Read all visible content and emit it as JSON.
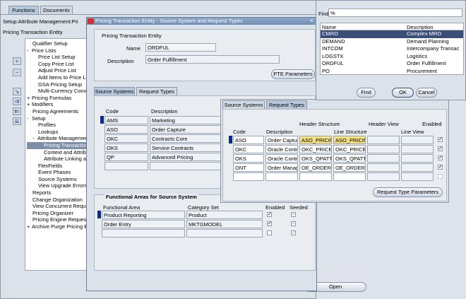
{
  "main": {
    "tabs": [
      "Functions",
      "Documents"
    ],
    "setup_label": "Setup:Attribute Management:Pri",
    "pricing_entity_label": "Pricing Transaction Entity",
    "tree": [
      {
        "label": "Qualifier Setup",
        "indent": 1,
        "prefix": ""
      },
      {
        "label": "Price Lists",
        "indent": 0,
        "prefix": "-"
      },
      {
        "label": "Price List Setup",
        "indent": 2,
        "prefix": ""
      },
      {
        "label": "Copy Price List",
        "indent": 2,
        "prefix": ""
      },
      {
        "label": "Adjust Price List",
        "indent": 2,
        "prefix": ""
      },
      {
        "label": "Add Items to Price L",
        "indent": 2,
        "prefix": ""
      },
      {
        "label": "GSA Pricing Setup",
        "indent": 2,
        "prefix": ""
      },
      {
        "label": "Multi-Currency Conve",
        "indent": 2,
        "prefix": ""
      },
      {
        "label": "Pricing Formulas",
        "indent": 0,
        "prefix": "+"
      },
      {
        "label": "Modifiers",
        "indent": 0,
        "prefix": "+"
      },
      {
        "label": "Pricing Agreements",
        "indent": 1,
        "prefix": ""
      },
      {
        "label": "Setup",
        "indent": 0,
        "prefix": "-"
      },
      {
        "label": "Profiles",
        "indent": 2,
        "prefix": ""
      },
      {
        "label": "Lookups",
        "indent": 2,
        "prefix": ""
      },
      {
        "label": "Attribute Management",
        "indent": 1,
        "prefix": "-"
      },
      {
        "label": "Pricing Transaction",
        "indent": 3,
        "prefix": "",
        "selected": true
      },
      {
        "label": "Context and Attribu",
        "indent": 3,
        "prefix": ""
      },
      {
        "label": "Attribute Linking an",
        "indent": 3,
        "prefix": ""
      },
      {
        "label": "FlexFields",
        "indent": 2,
        "prefix": ""
      },
      {
        "label": "Event Phases",
        "indent": 2,
        "prefix": ""
      },
      {
        "label": "Source Systems",
        "indent": 2,
        "prefix": ""
      },
      {
        "label": "View Upgrade Errors",
        "indent": 2,
        "prefix": ""
      },
      {
        "label": "Reports",
        "indent": 1,
        "prefix": ""
      },
      {
        "label": "Change Organization",
        "indent": 1,
        "prefix": ""
      },
      {
        "label": "View Concurrent Reque",
        "indent": 1,
        "prefix": ""
      },
      {
        "label": "Pricing Organizer",
        "indent": 1,
        "prefix": ""
      },
      {
        "label": "Pricing Engine Request Viewer",
        "indent": 1,
        "prefix": ""
      },
      {
        "label": "Archive Purge Pricing Entities",
        "indent": 0,
        "prefix": "+"
      }
    ],
    "side_buttons": [
      "+",
      "−",
      "↘",
      "⇉",
      "⇇",
      "⇊"
    ],
    "open_button": "Open"
  },
  "pte": {
    "title": "Pricing Transaction Entity - Source System and Request Types",
    "section_label": "Pricing Transaction Entity",
    "name_label": "Name",
    "name_value": "ORDFUL",
    "description_label": "Description",
    "description_value": "Order Fulfillment",
    "params_button": "PTE Parameters",
    "tabs": [
      "Source Systems",
      "Request Types"
    ],
    "col_code": "Code",
    "col_description": "Description",
    "rows": [
      {
        "code": "AMS",
        "description": "Marketing"
      },
      {
        "code": "ASO",
        "description": "Order Capture"
      },
      {
        "code": "OKC",
        "description": "Contracts Core"
      },
      {
        "code": "OKS",
        "description": "Service Contracts"
      },
      {
        "code": "QP",
        "description": "Advanced Pricing"
      },
      {
        "code": "",
        "description": ""
      }
    ],
    "functional_title": "Functional Areas for Source System",
    "fa_col_area": "Functional Area",
    "fa_col_category": "Category Set",
    "fa_col_enabled": "Enabled",
    "fa_col_seeded": "Seeded",
    "fa_rows": [
      {
        "area": "Product Reporting",
        "category": "Product",
        "enabled": true,
        "seeded": true
      },
      {
        "area": "Order Entry",
        "category": "MKTGMODEL",
        "enabled": true,
        "seeded": true
      },
      {
        "area": "",
        "category": "",
        "enabled": false,
        "seeded": true
      }
    ]
  },
  "request": {
    "tabs": [
      "Source Systems",
      "Request Types"
    ],
    "col_code": "Code",
    "col_description": "Description",
    "col_header_structure": "Header Structure",
    "col_line_structure": "Line Structure",
    "col_header_view": "Header View",
    "col_line_view": "Line View",
    "col_enabled": "Enabled",
    "rows": [
      {
        "code": "ASO",
        "description": "Order Captur",
        "header": "ASO_PRICIN",
        "line": "ASO_PRICIN",
        "enabled": true,
        "highlight": true
      },
      {
        "code": "OKC",
        "description": "Oracle Contr",
        "header": "OKC_PRICE_",
        "line": "OKC_PRICE_",
        "enabled": true,
        "highlight": false
      },
      {
        "code": "OKS",
        "description": "Oracle Contr",
        "header": "OKS_QPATT",
        "line": "OKS_QPATT",
        "enabled": true,
        "highlight": false
      },
      {
        "code": "ONT",
        "description": "Order Manag",
        "header": "OE_ORDER_",
        "line": "OE_ORDER_",
        "enabled": true,
        "highlight": false
      },
      {
        "code": "",
        "description": "",
        "header": "",
        "line": "",
        "enabled": false,
        "highlight": false
      }
    ],
    "params_button": "Request Type Parameters"
  },
  "find": {
    "label": "Find",
    "value": "%",
    "col_name": "Name",
    "col_description": "Description",
    "rows": [
      {
        "name": "CMRO",
        "description": "Complex MRO",
        "selected": true
      },
      {
        "name": "DEMAND",
        "description": "Demand Planning"
      },
      {
        "name": "INTCOM",
        "description": "Intercompany Transac"
      },
      {
        "name": "LOGSTX",
        "description": "Logistics"
      },
      {
        "name": "ORDFUL",
        "description": "Order Fulfillment"
      },
      {
        "name": "PO",
        "description": "Procurement"
      }
    ],
    "buttons": {
      "find": "Find",
      "ok": "OK",
      "cancel": "Cancel"
    }
  }
}
